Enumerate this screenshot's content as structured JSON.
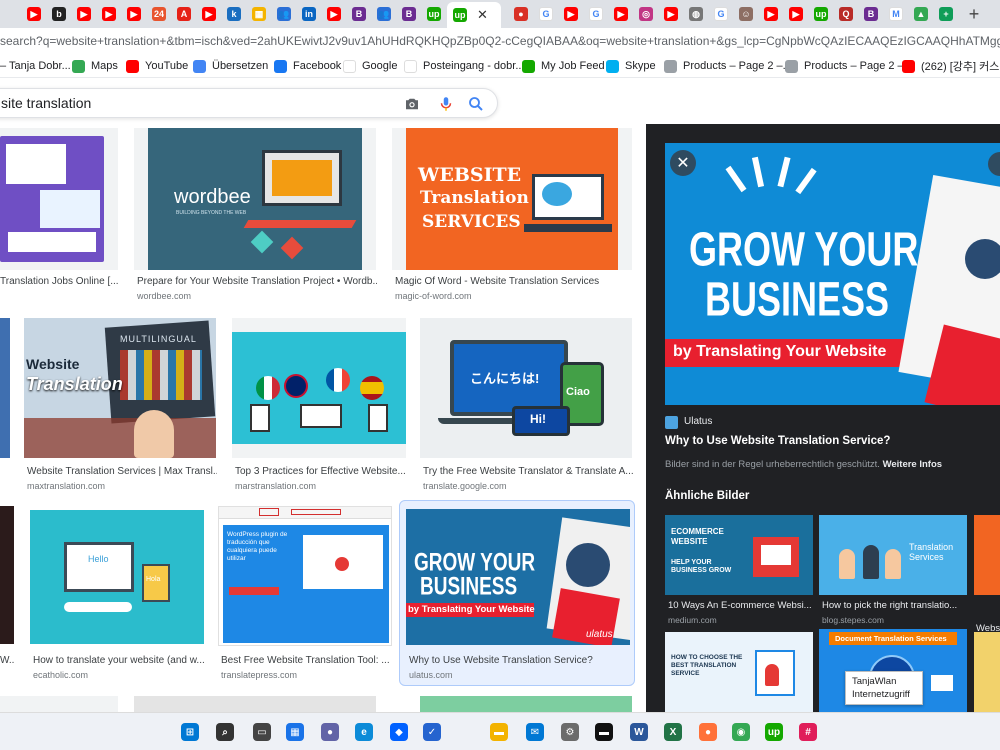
{
  "browser": {
    "tabs": [
      {
        "icon": "youtube-icon",
        "color": "#ff0000",
        "glyph": "▶"
      },
      {
        "icon": "bitly-icon",
        "color": "#222222",
        "glyph": "b"
      },
      {
        "icon": "youtube-icon",
        "color": "#ff0000",
        "glyph": "▶"
      },
      {
        "icon": "youtube-icon",
        "color": "#ff0000",
        "glyph": "▶"
      },
      {
        "icon": "youtube-icon",
        "color": "#ff0000",
        "glyph": "▶"
      },
      {
        "icon": "app-24-icon",
        "color": "#e8542e",
        "glyph": "24"
      },
      {
        "icon": "adobe-icon",
        "color": "#e62117",
        "glyph": "A"
      },
      {
        "icon": "youtube-icon",
        "color": "#ff0000",
        "glyph": "▶"
      },
      {
        "icon": "k-icon",
        "color": "#1a6ec0",
        "glyph": "k"
      },
      {
        "icon": "grid-app-icon",
        "color": "#f4b400",
        "glyph": "▦"
      },
      {
        "icon": "people-icon",
        "color": "#2b6fd6",
        "glyph": "👥"
      },
      {
        "icon": "linkedin-icon",
        "color": "#0a66c2",
        "glyph": "in"
      },
      {
        "icon": "youtube-icon",
        "color": "#ff0000",
        "glyph": "▶"
      },
      {
        "icon": "b-icon",
        "color": "#6b2c91",
        "glyph": "B"
      },
      {
        "icon": "people-icon",
        "color": "#2b6fd6",
        "glyph": "👥"
      },
      {
        "icon": "b-icon",
        "color": "#6b2c91",
        "glyph": "B"
      },
      {
        "icon": "upwork-icon",
        "color": "#14a800",
        "glyph": "up"
      },
      {
        "icon": "upwork-icon",
        "color": "#14a800",
        "glyph": "up"
      },
      {
        "icon": "record-icon",
        "color": "#d93025",
        "glyph": "●"
      },
      {
        "icon": "google-icon",
        "color": "#ffffff",
        "glyph": "G"
      },
      {
        "icon": "youtube-icon",
        "color": "#ff0000",
        "glyph": "▶"
      },
      {
        "icon": "google-icon",
        "color": "#ffffff",
        "glyph": "G"
      },
      {
        "icon": "youtube-icon",
        "color": "#ff0000",
        "glyph": "▶"
      },
      {
        "icon": "instagram-icon",
        "color": "#c13584",
        "glyph": "◎"
      },
      {
        "icon": "youtube-icon",
        "color": "#ff0000",
        "glyph": "▶"
      },
      {
        "icon": "globe-icon",
        "color": "#777777",
        "glyph": "◍"
      },
      {
        "icon": "google-icon",
        "color": "#ffffff",
        "glyph": "G"
      },
      {
        "icon": "profile-icon",
        "color": "#8d6e63",
        "glyph": "☺"
      },
      {
        "icon": "youtube-icon",
        "color": "#ff0000",
        "glyph": "▶"
      },
      {
        "icon": "youtube-icon",
        "color": "#ff0000",
        "glyph": "▶"
      },
      {
        "icon": "upwork-icon",
        "color": "#14a800",
        "glyph": "up"
      },
      {
        "icon": "quora-icon",
        "color": "#b92b27",
        "glyph": "Q"
      },
      {
        "icon": "b-icon",
        "color": "#6b2c91",
        "glyph": "B"
      },
      {
        "icon": "gmail-icon",
        "color": "#ffffff",
        "glyph": "M"
      },
      {
        "icon": "drive-icon",
        "color": "#34a853",
        "glyph": "▲"
      },
      {
        "icon": "sheets-plus-icon",
        "color": "#0f9d58",
        "glyph": "+"
      }
    ],
    "url": "search?q=website+translation+&tbm=isch&ved=2ahUKEwivtJ2v9uv1AhUHdRQKHQpZBp0Q2-cCegQIABAA&oq=website+translation+&gs_lcp=CgNpbWcQAzIECAAQEzIGCAAQHhATMggIABAIEB4QEzIICAAQ",
    "bookmarks": [
      {
        "label": "– Tanja Dobr...",
        "icon": "",
        "color": ""
      },
      {
        "label": "Maps",
        "icon": "maps-icon",
        "color": "#34a853"
      },
      {
        "label": "YouTube",
        "icon": "youtube-icon",
        "color": "#ff0000"
      },
      {
        "label": "Übersetzen",
        "icon": "translate-icon",
        "color": "#4285f4"
      },
      {
        "label": "Facebook",
        "icon": "facebook-icon",
        "color": "#1877f2"
      },
      {
        "label": "Google",
        "icon": "google-icon",
        "color": "#ffffff"
      },
      {
        "label": "Posteingang - dobr...",
        "icon": "gmail-icon",
        "color": "#ffffff"
      },
      {
        "label": "My Job Feed",
        "icon": "upwork-icon",
        "color": "#14a800"
      },
      {
        "label": "Skype",
        "icon": "skype-icon",
        "color": "#00aff0"
      },
      {
        "label": "Products – Page 2 –...",
        "icon": "globe-icon",
        "color": "#9aa0a6"
      },
      {
        "label": "Products – Page 2 –...",
        "icon": "globe-icon",
        "color": "#9aa0a6"
      },
      {
        "label": "(262) [강추] 커스터...",
        "icon": "youtube-icon",
        "color": "#ff0000"
      }
    ]
  },
  "search": {
    "query": "site translation"
  },
  "results": [
    {
      "title": "Translation Jobs Online [...",
      "site": "",
      "img": "mockup"
    },
    {
      "title": "Prepare for Your Website Translation Project • Wordb...",
      "site": "wordbee.com",
      "img": "wordbee",
      "logo": "wordbee",
      "logo_sub": "BUILDING BEYOND THE WEB"
    },
    {
      "title": "Magic Of Word - Website Translation Services",
      "site": "magic-of-word.com",
      "img": "magicofword",
      "l1": "WEBSITE",
      "l2": "Translation",
      "l3": "SERVICES"
    },
    {
      "title": "Website Translation Services | Max Transl...",
      "site": "maxtranslation.com",
      "img": "maxtrans",
      "l1": "Website",
      "l2": "Translation",
      "l3": "MULTILINGUAL"
    },
    {
      "title": "Top 3 Practices for Effective Website...",
      "site": "marstranslation.com",
      "img": "mars"
    },
    {
      "title": "Try the Free Website Translator & Translate A...",
      "site": "translate.google.com",
      "img": "gtrans",
      "l1": "こんにちは!",
      "l2": "Ciao",
      "l3": "Hi!"
    },
    {
      "title": "How to translate your website (and w...",
      "site": "ecatholic.com",
      "img": "ecatholic",
      "l1": "Hello",
      "l2": "Hola"
    },
    {
      "title": "Best Free Website Translation Tool: ...",
      "site": "translatepress.com",
      "img": "translatepress",
      "l1": "WordPress plugin de traducción que cualquiera puede utilizar"
    },
    {
      "title": "Why to Use Website Translation Service?",
      "site": "ulatus.com",
      "img": "ulatus",
      "l1": "GROW YOUR",
      "l2": "BUSINESS",
      "l3": "by Translating Your Website",
      "l4": "ulatus"
    }
  ],
  "panel": {
    "hero": {
      "l1": "GROW YOUR",
      "l2": "BUSINESS",
      "l3": "by Translating Your Website"
    },
    "source": "Ulatus",
    "title": "Why to Use Website Translation Service?",
    "copyright": "Bilder sind in der Regel urheberrechtlich geschützt.",
    "more_info": "Weitere Infos",
    "similar_heading": "Ähnliche Bilder",
    "similar": [
      {
        "title": "10 Ways An E-commerce Websi...",
        "site": "medium.com",
        "l1": "ECOMMERCE WEBSITE",
        "l2": "HELP YOUR BUSINESS GROW"
      },
      {
        "title": "How to pick the right translatio...",
        "site": "blog.stepes.com",
        "l1": "Translation Services"
      },
      {
        "title": "Webs",
        "site": "langu"
      },
      {
        "title": "",
        "site": "",
        "l1": "HOW TO CHOOSE THE BEST TRANSLATION SERVICE"
      },
      {
        "title": "",
        "site": "",
        "l1": "Document Translation Services"
      }
    ],
    "tooltip": {
      "line1": "TanjaWlan",
      "line2": "Internetzugriff"
    }
  },
  "taskbar": [
    {
      "icon": "windows-start-icon"
    },
    {
      "icon": "search-icon"
    },
    {
      "icon": "task-view-icon"
    },
    {
      "icon": "widgets-icon"
    },
    {
      "icon": "teams-chat-icon"
    },
    {
      "icon": "edge-icon"
    },
    {
      "icon": "dropbox-icon"
    },
    {
      "icon": "todo-icon"
    },
    {
      "icon": "file-explorer-icon"
    },
    {
      "icon": "mail-icon"
    },
    {
      "icon": "settings-icon"
    },
    {
      "icon": "terminal-icon"
    },
    {
      "icon": "word-icon"
    },
    {
      "icon": "excel-icon"
    },
    {
      "icon": "firefox-icon"
    },
    {
      "icon": "chrome-icon"
    },
    {
      "icon": "upwork-icon"
    },
    {
      "icon": "slack-icon"
    }
  ],
  "colors": {
    "accent_blue": "#1a73e8",
    "panel_bg": "#202124",
    "selected_tile": "#e8f0fe",
    "magic_orange": "#f26522",
    "ulatus_blue": "#1d6fa5",
    "ulatus_red": "#e8202f"
  }
}
